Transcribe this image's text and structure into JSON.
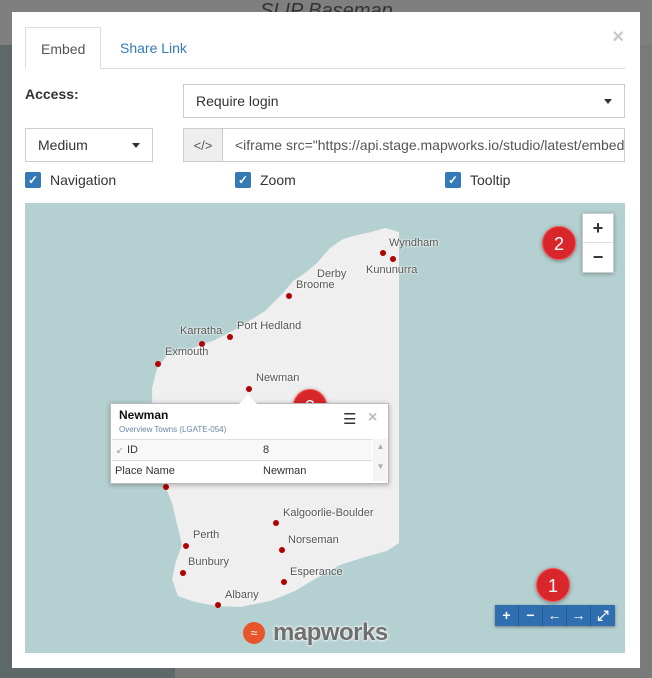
{
  "background": {
    "title": "SLIP Basemap"
  },
  "modal": {
    "tabs": [
      {
        "label": "Embed",
        "active": true
      },
      {
        "label": "Share Link",
        "active": false
      }
    ],
    "close_icon": "close-icon",
    "access_label": "Access:",
    "access_select": "Require login",
    "size_select": "Medium",
    "code_addon": "</>",
    "embed_code": "<iframe src=\"https://api.stage.mapworks.io/studio/latest/embed",
    "checkboxes": [
      {
        "label": "Navigation",
        "checked": true
      },
      {
        "label": "Zoom",
        "checked": true
      },
      {
        "label": "Tooltip",
        "checked": true
      }
    ]
  },
  "map": {
    "places": [
      "Wyndham",
      "Kununurra",
      "Derby",
      "Broome",
      "Port Hedland",
      "Karratha",
      "Exmouth",
      "Newman",
      "Kalgoorlie-Boulder",
      "Perth",
      "Norseman",
      "Bunbury",
      "Esperance",
      "Albany"
    ],
    "zoom_in": "+",
    "zoom_out": "−",
    "badges": [
      "1",
      "2",
      "3"
    ],
    "nav_buttons": [
      "+",
      "−",
      "←",
      "→",
      "⤢"
    ],
    "popup": {
      "title": "Newman",
      "subtitle": "Overview Towns (LGATE-054)",
      "rows": [
        {
          "key": "ID",
          "value": "8"
        },
        {
          "key": "Place Name",
          "value": "Newman"
        }
      ]
    },
    "logo": "mapworks",
    "colors": {
      "water": "#b5d0d1",
      "land": "#efefef",
      "marker": "#b00000",
      "accent": "#337ab7"
    }
  }
}
